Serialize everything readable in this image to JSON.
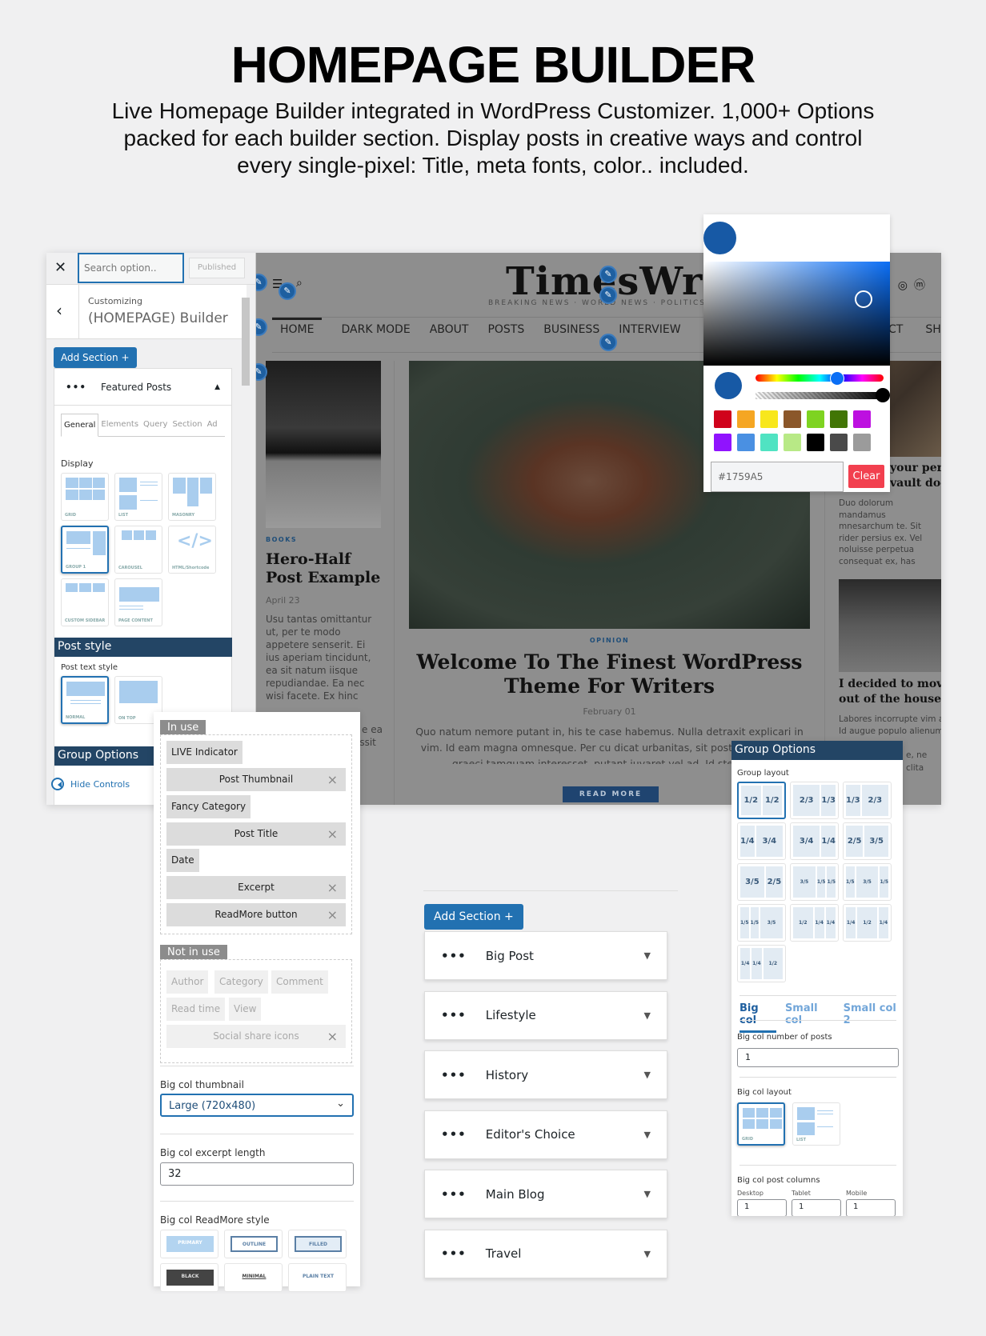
{
  "header": {
    "title": "HOMEPAGE BUILDER",
    "subtitle_lines": [
      "Live Homepage Builder integrated in WordPress Customizer. 1,000+ Options",
      "packed for each builder section. Display posts in creative ways and control",
      "every single-pixel: Title, meta fonts, color.. included."
    ]
  },
  "customizer": {
    "search_placeholder": "Search option..",
    "published_label": "Published",
    "customizing_label": "Customizing",
    "panel_title": "(HOMEPAGE) Builder",
    "add_section_label": "Add Section +",
    "section_name": "Featured Posts",
    "tabs": [
      "General",
      "Elements",
      "Query",
      "Section",
      "Ad"
    ],
    "display_label": "Display",
    "display_options": [
      "GRID",
      "LIST",
      "MASONRY",
      "GROUP 1",
      "CAROUSEL",
      "HTML/Shortcode",
      "CUSTOM SIDEBAR",
      "PAGE CONTENT"
    ],
    "display_selected": "GROUP 1",
    "post_style_heading": "Post style",
    "post_text_style_label": "Post text style",
    "post_text_styles": [
      "NORMAL",
      "ON TOP"
    ],
    "group_options_heading": "Group Options",
    "hide_controls_label": "Hide Controls"
  },
  "preview": {
    "logo": "TimesWriter",
    "tagline": "BREAKING NEWS · WORLD NEWS · POLITICS · S",
    "nav": [
      "HOME",
      "DARK MODE",
      "ABOUT",
      "POSTS",
      "BUSINESS",
      "INTERVIEW",
      "CT",
      "SHO"
    ],
    "left_post": {
      "category": "BOOKS",
      "title": "Hero-Half Post Example",
      "date": "April 23",
      "excerpt": "Usu tantas omittantur ut, per te modo appetere senserit. Ei ius aperiam tincidunt, ea sit natum iisque repudiandae. Ea nec wisi facete. Ex hinc",
      "excerpt_tail": [
        "e ea",
        "ossit"
      ]
    },
    "main_post": {
      "category": "OPINION",
      "title": "Welcome To The Finest WordPress Theme For Writers",
      "date": "February 01",
      "excerpt": "Quo natum nemore putant in, his te case habemus. Nulla detraxit explicari in vim. Id eam magna omnesque. Per cu dicat urbanitas, sit postulant disputa graeci tamquam interesset, putant iuvaret vel ad. Id stet malis",
      "read_more": "READ MORE"
    },
    "right_post_1": {
      "title": "your peri vault doo",
      "excerpt": "Duo dolorum mandamus mnesarchum te. Sit rider persius ex. Vel noluisse perpetua consequat ex, has"
    },
    "right_post_2": {
      "title": "I decided to move out of the house",
      "excerpt": "Labores incorrupte vim a Id augue populo alienum",
      "tail": "e, ne clita"
    }
  },
  "color_picker": {
    "value": "#1759A5",
    "clear_label": "Clear",
    "swatches": [
      "#d0021b",
      "#f5a623",
      "#f8e71c",
      "#8b572a",
      "#7ed321",
      "#417505",
      "#bd10e0",
      "#9013fe",
      "#4a90e2",
      "#50e3c2",
      "#b8e986",
      "#000000",
      "#4a4a4a",
      "#9b9b9b"
    ]
  },
  "elements_panel": {
    "in_use_label": "In use",
    "in_use": [
      "LIVE Indicator",
      "Post Thumbnail",
      "Fancy Category",
      "Post Title",
      "Date",
      "Excerpt",
      "ReadMore button"
    ],
    "not_in_use_label": "Not in use",
    "not_in_use": [
      "Author",
      "Category",
      "Comment",
      "Read time",
      "View",
      "Social share icons"
    ],
    "thumb_label": "Big col thumbnail",
    "thumb_value": "Large (720x480)",
    "excerpt_label": "Big col excerpt length",
    "excerpt_value": "32",
    "readmore_label": "Big col ReadMore style",
    "readmore_styles": [
      "PRIMARY",
      "OUTLINE",
      "FILLED",
      "BLACK",
      "MINIMAL",
      "PLAIN TEXT"
    ]
  },
  "sections": {
    "add_section_label": "Add Section +",
    "items": [
      "Big Post",
      "Lifestyle",
      "History",
      "Editor's Choice",
      "Main Blog",
      "Travel"
    ]
  },
  "group_options": {
    "heading": "Group Options",
    "layout_label": "Group layout",
    "layouts": [
      [
        "1/2",
        "1/2"
      ],
      [
        "2/3",
        "1/3"
      ],
      [
        "1/3",
        "2/3"
      ],
      [
        "1/4",
        "3/4"
      ],
      [
        "3/4",
        "1/4"
      ],
      [
        "2/5",
        "3/5"
      ],
      [
        "3/5",
        "2/5"
      ],
      [
        "3/5",
        "1/5",
        "1/5"
      ],
      [
        "1/5",
        "3/5",
        "1/5"
      ],
      [
        "1/5",
        "1/5",
        "3/5"
      ],
      [
        "1/2",
        "1/4",
        "1/4"
      ],
      [
        "1/4",
        "1/2",
        "1/4"
      ],
      [
        "1/4",
        "1/4",
        "1/2"
      ]
    ],
    "tabs": [
      "Big col",
      "Small col",
      "Small col 2"
    ],
    "num_posts_label": "Big col number of posts",
    "num_posts_value": "1",
    "layout2_label": "Big col layout",
    "layout2_options": [
      "GRID",
      "LIST"
    ],
    "columns_label": "Big col post columns",
    "columns": [
      {
        "label": "Desktop",
        "value": "1"
      },
      {
        "label": "Tablet",
        "value": "1"
      },
      {
        "label": "Mobile",
        "value": "1"
      }
    ]
  }
}
